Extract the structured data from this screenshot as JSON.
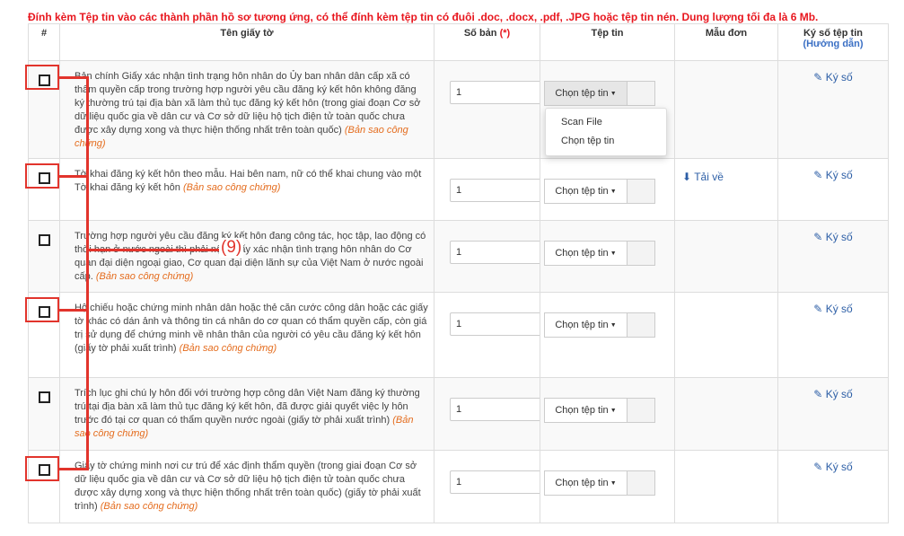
{
  "notice": "Đính kèm Tệp tin vào các thành phần hồ sơ tương ứng, có thể đính kèm tệp tin có đuôi .doc, .docx, .pdf, .JPG hoặc tệp tin nén. Dung lượng tối đa là 6 Mb.",
  "headers": {
    "num": "#",
    "name": "Tên giấy tờ",
    "qty": "Số bản",
    "qty_req": "(*)",
    "file": "Tệp tin",
    "form": "Mẫu đơn",
    "sign": "Ký số tệp tin",
    "sign_guide": "(Hướng dẫn)"
  },
  "rows": [
    {
      "name": "Bản chính Giấy xác nhận tình trạng hôn nhân do Ủy ban nhân dân cấp xã có thẩm quyền cấp trong trường hợp người yêu cầu đăng ký kết hôn không đăng ký thường trú tại địa bàn xã làm thủ tục đăng ký kết hôn (trong giai đoạn Cơ sở dữ liệu quốc gia về dân cư và Cơ sở dữ liệu hộ tịch điện tử toàn quốc chưa được xây dựng xong và thực hiện thống nhất trên toàn quốc)",
      "copy": "(Bản sao công chứng)",
      "qty": "1",
      "file_label": "Chọn tệp tin",
      "form": "",
      "sign": "Ký số"
    },
    {
      "name": "Tờ khai đăng ký kết hôn theo mẫu. Hai bên nam, nữ có thể khai chung vào một Tờ khai đăng ký kết hôn",
      "copy": "(Bản sao công chứng)",
      "qty": "1",
      "file_label": "Chọn tệp tin",
      "form": "Tải về",
      "sign": "Ký số"
    },
    {
      "name": "Trường hợp người yêu cầu đăng ký kết hôn đang công tác, học tập, lao động có thời hạn ở nước ngoài thì phải nộp Giấy xác nhận tình trạng hôn nhân do Cơ quan đại diện ngoại giao, Cơ quan đại diện lãnh sự của Việt Nam ở nước ngoài cấp.",
      "copy": "(Bản sao công chứng)",
      "qty": "1",
      "file_label": "Chọn tệp tin",
      "form": "",
      "sign": "Ký số"
    },
    {
      "name": "Hộ chiếu hoặc chứng minh nhân dân hoặc thẻ căn cước công dân hoặc các giấy tờ khác có dán ảnh và thông tin cá nhân do cơ quan có thẩm quyền cấp, còn giá trị sử dụng để chứng minh về nhân thân của người có yêu cầu đăng ký kết hôn (giấy tờ phải xuất trình)",
      "copy": "(Bản sao công chứng)",
      "qty": "1",
      "file_label": "Chọn tệp tin",
      "form": "",
      "sign": "Ký số"
    },
    {
      "name": "Trích lục ghi chú ly hôn đối với trường hợp công dân Việt Nam đăng ký thường trú tại địa bàn xã làm thủ tục đăng ký kết hôn, đã được giải quyết việc ly hôn trước đó tại cơ quan có thẩm quyền nước ngoài (giấy tờ phải xuất trình)",
      "copy": "(Bản sao công chứng)",
      "qty": "1",
      "file_label": "Chọn tệp tin",
      "form": "",
      "sign": "Ký số"
    },
    {
      "name": "Giấy tờ chứng minh nơi cư trú để xác định thẩm quyền (trong giai đoạn Cơ sở dữ liệu quốc gia về dân cư và Cơ sở dữ liệu hộ tịch điện tử toàn quốc chưa được xây dựng xong và thực hiện thống nhất trên toàn quốc) (giấy tờ phải xuất trình)",
      "copy": "(Bản sao công chứng)",
      "qty": "1",
      "file_label": "Chọn tệp tin",
      "form": "",
      "sign": "Ký số"
    }
  ],
  "dropdown": {
    "items": [
      "Scan File",
      "Chọn tệp tin"
    ]
  },
  "callout": "(9)",
  "colors": {
    "notice": "#e8161e",
    "link": "#2c5ea6",
    "copy_note": "#e46b1c",
    "highlight": "#e2342c"
  }
}
